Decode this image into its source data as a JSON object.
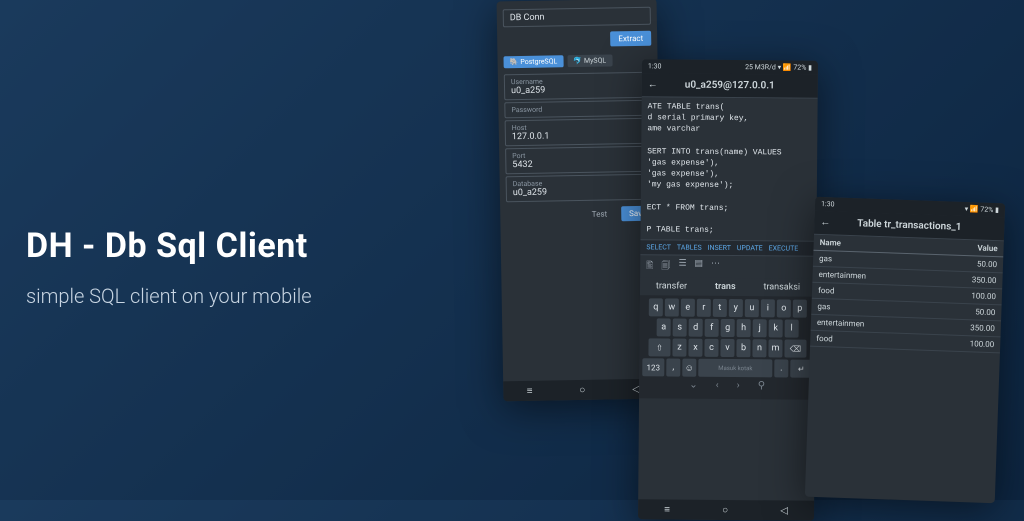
{
  "headline": {
    "title": "DH - Db Sql Client",
    "subtitle": "simple SQL client on your mobile"
  },
  "status": {
    "time": "1:30",
    "net": "25 M3R/d",
    "batt": "72%"
  },
  "phone1": {
    "conn_label": "DB Conn",
    "extract": "Extract",
    "db_types": {
      "pg": "PostgreSQL",
      "mysql": "MySQL"
    },
    "fields": {
      "username": {
        "label": "Username",
        "value": "u0_a259"
      },
      "password": {
        "label": "Password",
        "value": ""
      },
      "host": {
        "label": "Host",
        "value": "127.0.0.1"
      },
      "port": {
        "label": "Port",
        "value": "5432"
      },
      "database": {
        "label": "Database",
        "value": "u0_a259"
      }
    },
    "test": "Test",
    "save": "Save"
  },
  "phone2": {
    "title": "u0_a259@127.0.0.1",
    "sql": "ATE TABLE trans(\nd serial primary key,\name varchar\n\nSERT INTO trans(name) VALUES\n'gas expense'),\n'gas expense'),\n'my gas expense');\n\nECT * FROM trans;\n\nP TABLE trans;",
    "actions": [
      "SELECT",
      "TABLES",
      "INSERT",
      "UPDATE",
      "EXECUTE"
    ],
    "suggest": {
      "left": "transfer",
      "mid": "trans",
      "right": "transaksi"
    },
    "keys_r1": [
      "q",
      "w",
      "e",
      "r",
      "t",
      "y",
      "u",
      "i",
      "o",
      "p"
    ],
    "keys_r2": [
      "a",
      "s",
      "d",
      "f",
      "g",
      "h",
      "j",
      "k",
      "l"
    ],
    "keys_r3": [
      "z",
      "x",
      "c",
      "v",
      "b",
      "n",
      "m"
    ],
    "num": "123",
    "space_hint": "Masuk kotak"
  },
  "phone3": {
    "title": "Table tr_transactions_1",
    "cols": {
      "name": "Name",
      "value": "Value"
    },
    "rows": [
      {
        "name": "gas",
        "value": "50.00"
      },
      {
        "name": "entertainmen",
        "value": "350.00"
      },
      {
        "name": "food",
        "value": "100.00"
      },
      {
        "name": "gas",
        "value": "50.00"
      },
      {
        "name": "entertainmen",
        "value": "350.00"
      },
      {
        "name": "food",
        "value": "100.00"
      }
    ]
  }
}
